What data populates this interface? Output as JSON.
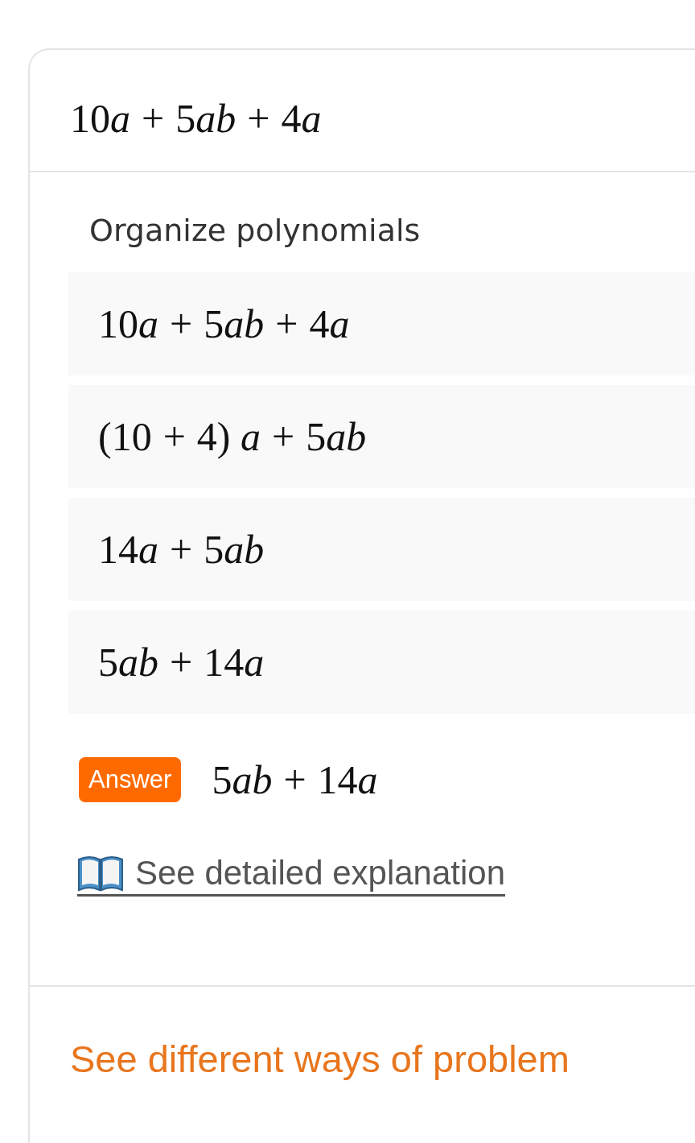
{
  "problem": [
    {
      "kind": "number",
      "text": "10"
    },
    {
      "kind": "variable",
      "text": "a"
    },
    {
      "kind": "operator",
      "text": "+"
    },
    {
      "kind": "number",
      "text": "5"
    },
    {
      "kind": "variable",
      "text": "ab"
    },
    {
      "kind": "operator",
      "text": "+"
    },
    {
      "kind": "number",
      "text": "4"
    },
    {
      "kind": "variable",
      "text": "a"
    }
  ],
  "section_title": "Organize polynomials",
  "steps": [
    [
      {
        "kind": "number",
        "text": "10"
      },
      {
        "kind": "variable",
        "text": "a"
      },
      {
        "kind": "operator",
        "text": "+"
      },
      {
        "kind": "number",
        "text": "5"
      },
      {
        "kind": "variable",
        "text": "ab"
      },
      {
        "kind": "operator",
        "text": "+"
      },
      {
        "kind": "number",
        "text": "4"
      },
      {
        "kind": "variable",
        "text": "a"
      }
    ],
    [
      {
        "kind": "number",
        "text": "(10"
      },
      {
        "kind": "operator",
        "text": "+"
      },
      {
        "kind": "number",
        "text": "4)"
      },
      {
        "kind": "variable",
        "text": " a"
      },
      {
        "kind": "operator",
        "text": "+"
      },
      {
        "kind": "number",
        "text": "5"
      },
      {
        "kind": "variable",
        "text": "ab"
      }
    ],
    [
      {
        "kind": "number",
        "text": "14"
      },
      {
        "kind": "variable",
        "text": "a"
      },
      {
        "kind": "operator",
        "text": "+"
      },
      {
        "kind": "number",
        "text": "5"
      },
      {
        "kind": "variable",
        "text": "ab"
      }
    ],
    [
      {
        "kind": "number",
        "text": "5"
      },
      {
        "kind": "variable",
        "text": "ab"
      },
      {
        "kind": "operator",
        "text": "+"
      },
      {
        "kind": "number",
        "text": "14"
      },
      {
        "kind": "variable",
        "text": "a"
      }
    ]
  ],
  "answer": {
    "badge": "Answer",
    "expression": [
      {
        "kind": "number",
        "text": "5"
      },
      {
        "kind": "variable",
        "text": "ab"
      },
      {
        "kind": "operator",
        "text": "+"
      },
      {
        "kind": "number",
        "text": "14"
      },
      {
        "kind": "variable",
        "text": "a"
      }
    ]
  },
  "explanation_link": "See detailed explanation",
  "other_methods_link": "See different ways of problem"
}
